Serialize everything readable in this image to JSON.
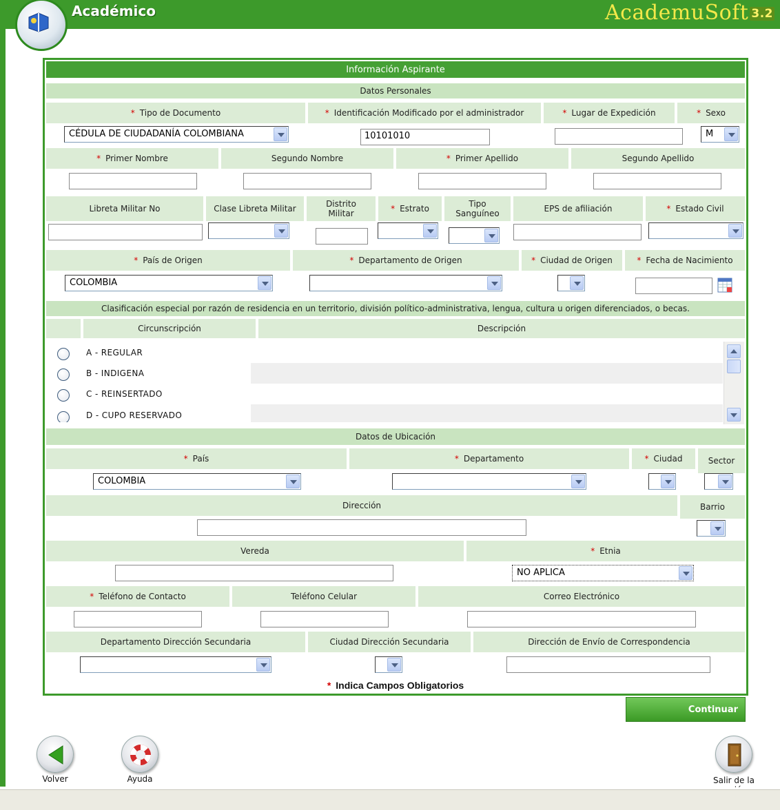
{
  "header": {
    "title": "Académico",
    "brand": "AcademuSoft",
    "brand_version": "3.2"
  },
  "form": {
    "title": "Información Aspirante",
    "personal_section": "Datos Personales",
    "labels": {
      "tipo_documento": "Tipo de Documento",
      "identificacion": "Identificación Modificado por el administrador",
      "lugar_expedicion": "Lugar de Expedición",
      "sexo": "Sexo",
      "primer_nombre": "Primer Nombre",
      "segundo_nombre": "Segundo Nombre",
      "primer_apellido": "Primer Apellido",
      "segundo_apellido": "Segundo Apellido",
      "libreta_militar": "Libreta Militar No",
      "clase_libreta": "Clase Libreta Militar",
      "distrito_militar": "Distrito Militar",
      "estrato": "Estrato",
      "tipo_sanguineo": "Tipo Sanguíneo",
      "eps": "EPS de afiliación",
      "estado_civil": "Estado Civil",
      "pais_origen": "País de Origen",
      "departamento_origen": "Departamento de Origen",
      "ciudad_origen": "Ciudad de Origen",
      "fecha_nacimiento": "Fecha de Nacimiento"
    },
    "values": {
      "tipo_documento": "CÉDULA DE CIUDADANÍA COLOMBIANA",
      "identificacion": "10101010",
      "lugar_expedicion": "",
      "sexo": "M",
      "pais_origen": "COLOMBIA"
    },
    "classification": {
      "title": "Clasificación especial por razón de residencia en un territorio, división político-administrativa, lengua, cultura u origen diferenciados, o becas.",
      "col_circunscripcion": "Circunscripción",
      "col_descripcion": "Descripción",
      "options": [
        {
          "label": "A - REGULAR"
        },
        {
          "label": "B - INDIGENA"
        },
        {
          "label": "C - REINSERTADO"
        },
        {
          "label": "D - CUPO RESERVADO"
        }
      ]
    },
    "location_section": "Datos de Ubicación",
    "location_labels": {
      "pais": "País",
      "departamento": "Departamento",
      "ciudad": "Ciudad",
      "sector": "Sector",
      "direccion": "Dirección",
      "barrio": "Barrio",
      "vereda": "Vereda",
      "etnia": "Etnia",
      "telefono_contacto": "Teléfono de Contacto",
      "telefono_celular": "Teléfono Celular",
      "correo": "Correo Electrónico",
      "depto_secundaria": "Departamento Dirección Secundaria",
      "ciudad_secundaria": "Ciudad Dirección Secundaria",
      "direccion_envio": "Dirección de Envío de Correspondencia"
    },
    "location_values": {
      "pais": "COLOMBIA",
      "etnia": "NO APLICA"
    },
    "required_note": "Indica Campos Obligatorios",
    "required_mark": "*"
  },
  "actions": {
    "continue": "Continuar",
    "back": "Volver",
    "help": "Ayuda",
    "logout": "Salir de la sesión"
  }
}
